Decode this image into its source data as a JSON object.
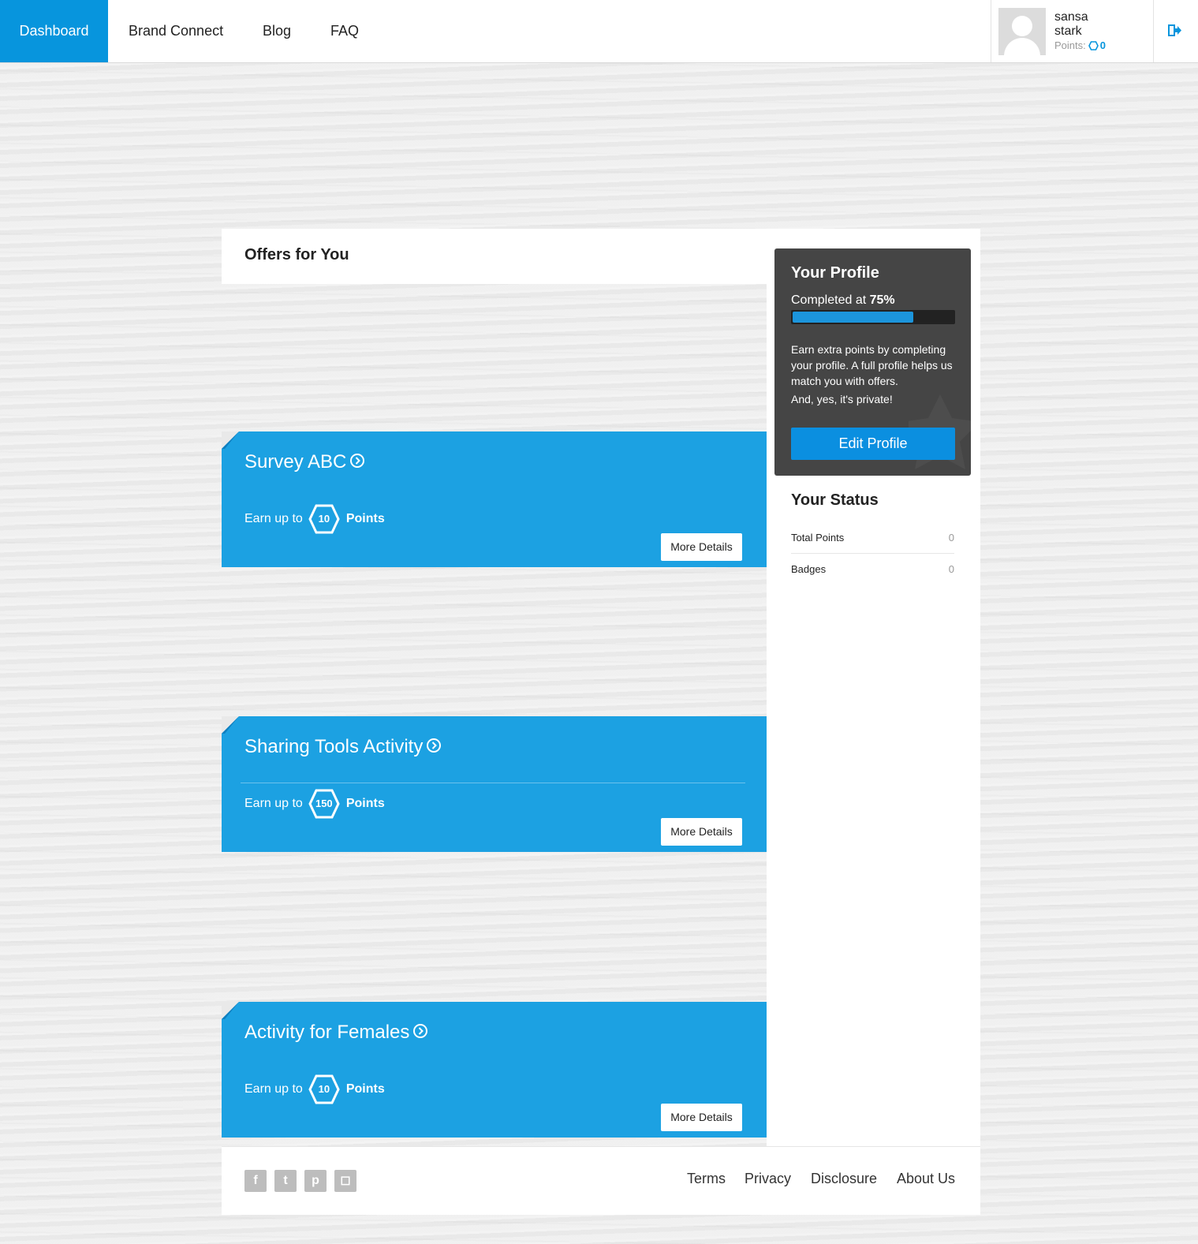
{
  "nav": {
    "items": [
      {
        "label": "Dashboard",
        "active": true
      },
      {
        "label": "Brand Connect",
        "active": false
      },
      {
        "label": "Blog",
        "active": false
      },
      {
        "label": "FAQ",
        "active": false
      }
    ]
  },
  "user": {
    "first_name": "sansa",
    "last_name": "stark",
    "points_label": "Points:",
    "points_value": "0",
    "avatar_icon": "avatar-placeholder-icon",
    "logout_icon": "logout-icon"
  },
  "offers": {
    "title": "Offers for You",
    "items": [
      {
        "title": "Survey ABC",
        "earn_label": "Earn up to",
        "points": "10",
        "points_label": "Points",
        "button": "More Details"
      },
      {
        "title": "Sharing Tools Activity",
        "earn_label": "Earn up to",
        "points": "150",
        "points_label": "Points",
        "button": "More Details"
      },
      {
        "title": "Activity for Females",
        "earn_label": "Earn up to",
        "points": "10",
        "points_label": "Points",
        "button": "More Details"
      }
    ]
  },
  "profile": {
    "title": "Your Profile",
    "completed_label": "Completed at",
    "completed_value": "75%",
    "progress_fraction": 0.75,
    "description": "Earn extra points by completing your profile. A full profile helps us match you with offers.",
    "private_note": "And, yes, it's private!",
    "edit_button": "Edit Profile"
  },
  "status": {
    "title": "Your Status",
    "rows": [
      {
        "label": "Total Points",
        "value": "0"
      },
      {
        "label": "Badges",
        "value": "0"
      }
    ]
  },
  "footer": {
    "social": [
      {
        "icon": "facebook-icon",
        "glyph": "f"
      },
      {
        "icon": "twitter-icon",
        "glyph": "t"
      },
      {
        "icon": "pinterest-icon",
        "glyph": "p"
      },
      {
        "icon": "instagram-icon",
        "glyph": "◻"
      }
    ],
    "links": [
      "Terms",
      "Privacy",
      "Disclosure",
      "About Us"
    ]
  },
  "colors": {
    "accent": "#0795dd",
    "offer_bg": "#1ca1e2",
    "profile_card_bg": "#454545"
  }
}
